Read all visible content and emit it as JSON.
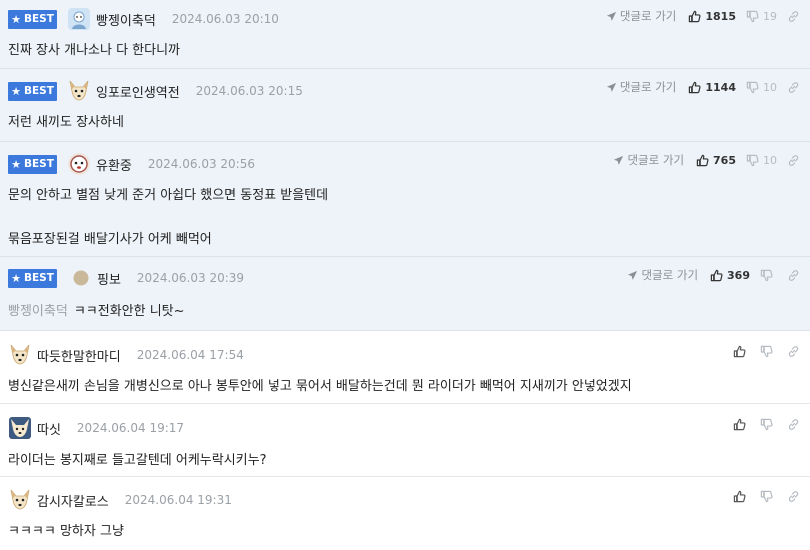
{
  "ui": {
    "best_label": "BEST",
    "reply_label": "댓글로 가기"
  },
  "comments": [
    {
      "nick": "빵젱이축덕",
      "date": "2024.06.03 20:10",
      "lines": [
        "진짜 장사 개나소나 다 한다니까"
      ],
      "up": "1815",
      "down": "19"
    },
    {
      "nick": "잉포로인생역전",
      "date": "2024.06.03 20:15",
      "lines": [
        "저런 새끼도 장사하네"
      ],
      "up": "1144",
      "down": "10"
    },
    {
      "nick": "유환중",
      "date": "2024.06.03 20:56",
      "lines": [
        "문의 안하고 별점 낮게 준거 아쉽다 했으면 동정표 받을텐데",
        "묶음포장된걸 배달기사가 어케 빼먹어"
      ],
      "up": "765",
      "down": "10"
    },
    {
      "nick": "핑보",
      "date": "2024.06.03 20:39",
      "mention": "빵젱이축덕",
      "lines": [
        "ㅋㅋ전화안한 니탓~"
      ],
      "up": "369"
    },
    {
      "nick": "따듯한말한마디",
      "date": "2024.06.04 17:54",
      "lines": [
        "병신같은새끼 손님을 개병신으로 아나 봉투안에 넣고 묶어서 배달하는건데 뭔 라이더가 빼먹어 지새끼가 안넣었겠지"
      ]
    },
    {
      "nick": "따싯",
      "date": "2024.06.04 19:17",
      "lines": [
        "라이더는 봉지째로 들고갈텐데 어케누락시키누?"
      ]
    },
    {
      "nick": "감시자칼로스",
      "date": "2024.06.04 19:31",
      "lines": [
        "ㅋㅋㅋㅋ 망하자 그냥"
      ]
    }
  ],
  "icons": {
    "badge": "star-icon",
    "reply": "arrow-icon",
    "up": "thumbs-up-icon",
    "down": "thumbs-down-icon",
    "link": "link-icon"
  },
  "colors": {
    "best_bg": "#eef3f9",
    "badge": "#3c79dc",
    "meta_gray": "#9aa0a6"
  }
}
